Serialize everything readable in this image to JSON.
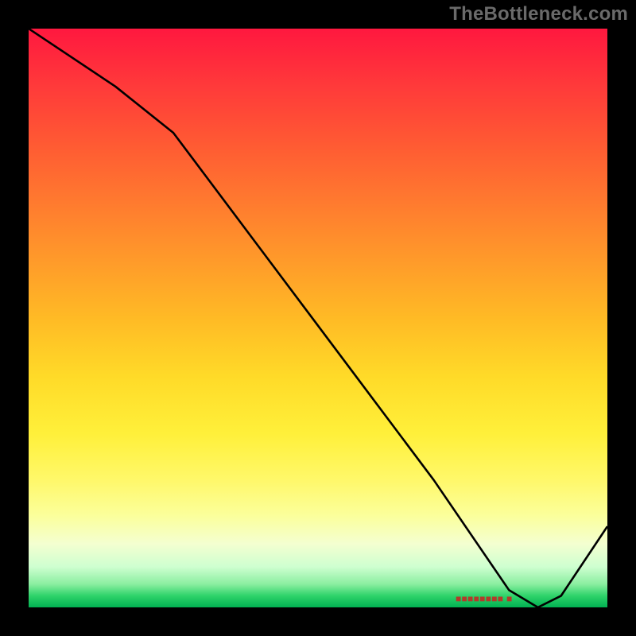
{
  "watermark": "TheBottleneck.com",
  "baseline_marker_text": "■■■■■■■■ ■",
  "chart_data": {
    "type": "line",
    "title": "",
    "xlabel": "",
    "ylabel": "",
    "xlim": [
      0,
      100
    ],
    "ylim": [
      0,
      100
    ],
    "axes_visible": false,
    "background": "rainbow-gradient-red-to-green",
    "series": [
      {
        "name": "curve",
        "color": "#000000",
        "x": [
          0,
          15,
          25,
          40,
          55,
          70,
          83,
          88,
          92,
          100
        ],
        "values": [
          100,
          90,
          82,
          62,
          42,
          22,
          3,
          0,
          2,
          14
        ]
      }
    ],
    "annotations": [
      {
        "name": "baseline-marker",
        "x": 82,
        "y": 1.2,
        "text": "■■■■■■■■ ■"
      }
    ]
  }
}
